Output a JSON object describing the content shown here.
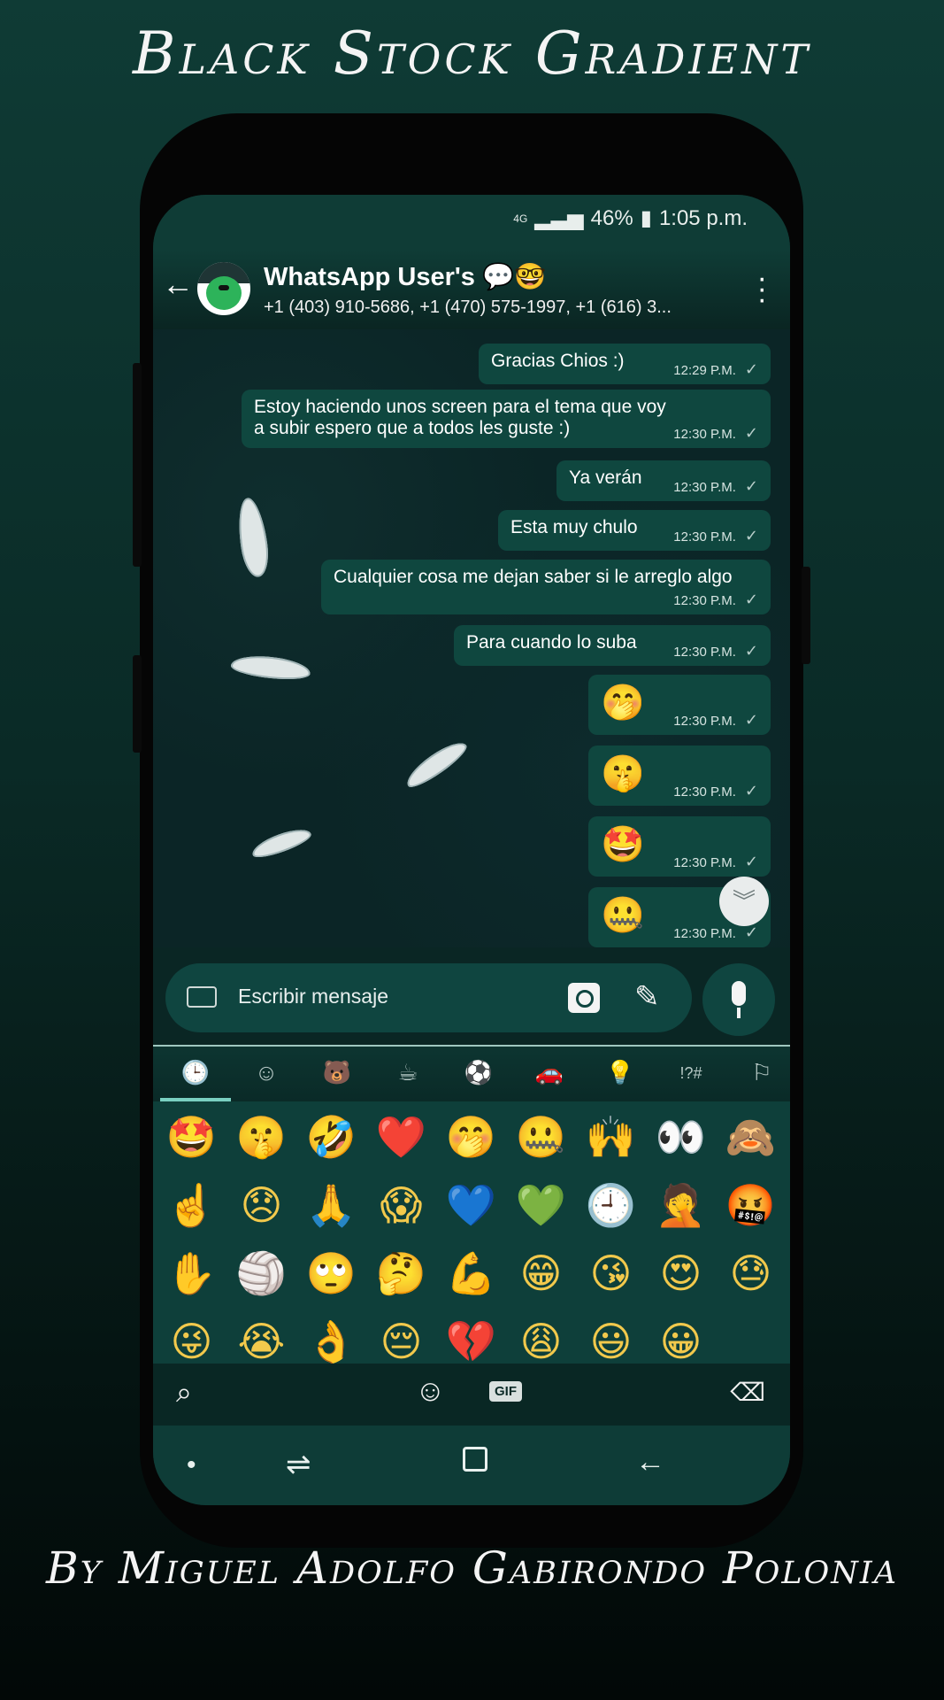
{
  "promo": {
    "title": "Black Stock Gradient",
    "credit": "By Miguel Adolfo Gabirondo Polonia"
  },
  "status_bar": {
    "network": "4G",
    "battery": "46%",
    "time": "1:05 p.m."
  },
  "chat_header": {
    "back_icon": "arrow-left-icon",
    "name": "WhatsApp User's 💬🤓",
    "participants": "+1 (403) 910-5686, +1 (470) 575-1997, +1 (616) 3...",
    "menu_icon": "more-vert-icon"
  },
  "messages": [
    {
      "text": "Gracias Chios :)",
      "time": "12:29 P.M."
    },
    {
      "text": "Estoy haciendo unos screen para el tema que voy a subir espero que a todos les guste :)",
      "time": "12:30 P.M."
    },
    {
      "text": "Ya verán",
      "time": "12:30 P.M."
    },
    {
      "text": "Esta muy chulo",
      "time": "12:30 P.M."
    },
    {
      "text": "Cualquier cosa me dejan saber si le arreglo algo",
      "time": "12:30 P.M."
    },
    {
      "text": "Para cuando lo suba",
      "time": "12:30 P.M."
    },
    {
      "text": "🤭",
      "time": "12:30 P.M."
    },
    {
      "text": "🤫",
      "time": "12:30 P.M."
    },
    {
      "text": "🤩",
      "time": "12:30 P.M."
    },
    {
      "text": "🤐",
      "time": "12:30 P.M."
    }
  ],
  "tick": "✓",
  "scroll_down_icon": "double-chevron-down-icon",
  "composer": {
    "placeholder": "Escribir mensaje",
    "keyboard_icon": "keyboard-icon",
    "camera_icon": "camera-icon",
    "attach_icon": "paperclip-icon",
    "mic_icon": "mic-icon"
  },
  "emoji_categories": [
    "🕒",
    "☺",
    "🐻",
    "☕",
    "⚽",
    "🚗",
    "💡",
    "!?#",
    "⚐"
  ],
  "emoji_grid": [
    "🤩",
    "🤫",
    "🤣",
    "❤️",
    "🤭",
    "🤐",
    "🙌",
    "👀",
    "🙈",
    "☝️",
    "😞",
    "🙏",
    "😱",
    "💙",
    "💚",
    "🕘",
    "🤦",
    "🤬",
    "✋",
    "🏐",
    "🙄",
    "🤔",
    "💪",
    "😁",
    "😘",
    "😍",
    "😓",
    "😜",
    "😭",
    "👌",
    "😔",
    "💔",
    "😩",
    "😃",
    "😀"
  ],
  "kb_bottom": {
    "search": "⌕",
    "emoji": "☺",
    "gif": "GIF",
    "delete": "⌫"
  },
  "nav_bar": {
    "dot": "•",
    "recent": "⇌",
    "back": "←"
  },
  "colors": {
    "bubble": "#0f473f",
    "header": "#0f3c36",
    "accent": "#79d0c1"
  }
}
